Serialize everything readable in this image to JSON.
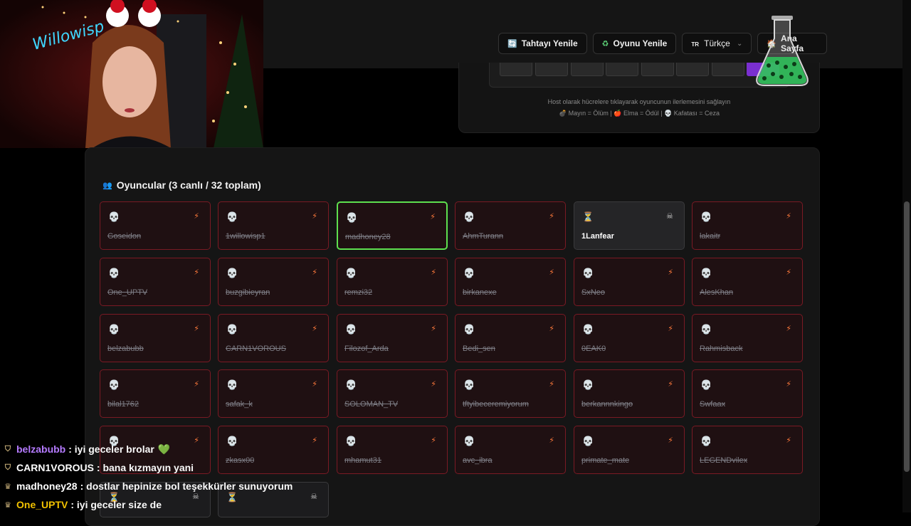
{
  "toolbar": {
    "refresh_board": "Tahtayı Yenile",
    "restart_game": "Oyunu Yenile",
    "language_code": "TR",
    "language": "Türkçe",
    "home": "Ana Sayfa"
  },
  "board": {
    "hint_line1": "Host olarak hücrelere tıklayarak oyuncunun ilerlemesini sağlayın",
    "hint_line2": "💣 Mayın = Ölüm | 🍎 Elma = Ödül | 💀 Kafatası = Ceza"
  },
  "players": {
    "title": "Oyuncular (3 canlı / 32 toplam)",
    "list": [
      {
        "name": "Goseidon",
        "status": "dead"
      },
      {
        "name": "1willowisp1",
        "status": "dead"
      },
      {
        "name": "madhoney28",
        "status": "dead",
        "highlight": true
      },
      {
        "name": "AhmTurann",
        "status": "dead"
      },
      {
        "name": "1Lanfear",
        "status": "alive"
      },
      {
        "name": "lakaitr",
        "status": "dead"
      },
      {
        "name": "One_UPTV",
        "status": "dead"
      },
      {
        "name": "buzgibieyran",
        "status": "dead"
      },
      {
        "name": "remzi32",
        "status": "dead"
      },
      {
        "name": "birkanexe",
        "status": "dead"
      },
      {
        "name": "SxNeo",
        "status": "dead"
      },
      {
        "name": "AlesKhan",
        "status": "dead"
      },
      {
        "name": "belzabubb",
        "status": "dead"
      },
      {
        "name": "CARN1VOROUS",
        "status": "dead"
      },
      {
        "name": "Filozof_Arda",
        "status": "dead"
      },
      {
        "name": "Bedi_sen",
        "status": "dead"
      },
      {
        "name": "0EAK0",
        "status": "dead"
      },
      {
        "name": "Rahmisback",
        "status": "dead"
      },
      {
        "name": "bilal1762",
        "status": "dead"
      },
      {
        "name": "safak_k",
        "status": "dead"
      },
      {
        "name": "SOLOMAN_TV",
        "status": "dead"
      },
      {
        "name": "tftyibeceremiyorum",
        "status": "dead"
      },
      {
        "name": "berkannnkingo",
        "status": "dead"
      },
      {
        "name": "Swfaax",
        "status": "dead"
      },
      {
        "name": "",
        "status": "dead"
      },
      {
        "name": "zkasx00",
        "status": "dead"
      },
      {
        "name": "mhamut31",
        "status": "dead"
      },
      {
        "name": "avc_ibra",
        "status": "dead"
      },
      {
        "name": "primate_mate",
        "status": "dead"
      },
      {
        "name": "LEGENDvilex",
        "status": "dead"
      }
    ]
  },
  "chat": [
    {
      "user": "belzabubb",
      "text": ": iyi geceler brolar",
      "color": "#b57bff",
      "emoji": "💚",
      "badge": "shield"
    },
    {
      "user": "CARN1VOROUS",
      "text": ": bana kızmayın yani",
      "color": "#ffffff",
      "emoji": "",
      "badge": "shield"
    },
    {
      "user": "madhoney28",
      "text": ": dostlar hepinize bol teşekkürler sunuyorum",
      "color": "#ffffff",
      "emoji": "",
      "badge": "crown"
    },
    {
      "user": "One_UPTV",
      "text": ": iyi geceler size de",
      "color": "#f2c200",
      "emoji": "",
      "badge": "crown"
    }
  ],
  "icons": {
    "dead": "skull-icon",
    "alive": "hourglass-icon",
    "action_dead": "lightning-icon",
    "action_alive": "crossbones-icon"
  }
}
